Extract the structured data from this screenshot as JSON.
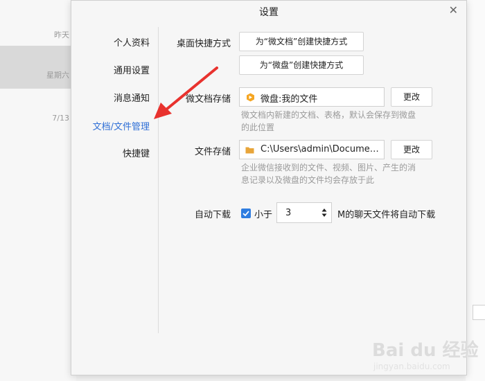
{
  "background": {
    "chat_list": [
      {
        "time": "昨天"
      },
      {
        "time": "星期六"
      },
      {
        "time": "7/13"
      }
    ]
  },
  "dialog": {
    "title": "设置",
    "close_icon": "close-icon"
  },
  "nav": {
    "items": [
      {
        "label": "个人资料"
      },
      {
        "label": "通用设置"
      },
      {
        "label": "消息通知"
      },
      {
        "label": "文档/文件管理",
        "active": true
      },
      {
        "label": "快捷键"
      }
    ]
  },
  "desktop_shortcut": {
    "label": "桌面快捷方式",
    "btn_doc": "为“微文档”创建快捷方式",
    "btn_disk": "为“微盘”创建快捷方式"
  },
  "doc_storage": {
    "label": "微文档存储",
    "value": "微盘:我的文件",
    "change": "更改",
    "hint": "微文档内新建的文档、表格，默认会保存到微盘的此位置"
  },
  "file_storage": {
    "label": "文件存储",
    "value": "C:\\Users\\admin\\Document...",
    "change": "更改",
    "hint": "企业微信接收到的文件、视频、图片、产生的消息记录以及微盘的文件均会存放于此"
  },
  "auto_download": {
    "label": "自动下载",
    "checked": true,
    "prefix": "小于",
    "value": "3",
    "suffix": "M的聊天文件将自动下载"
  },
  "colors": {
    "accent": "#2f6fd6",
    "arrow": "#e8322e",
    "checkbox": "#2f7de0"
  },
  "watermark": {
    "main": "Bai du 经验",
    "sub": "jingyan.baidu.com"
  }
}
